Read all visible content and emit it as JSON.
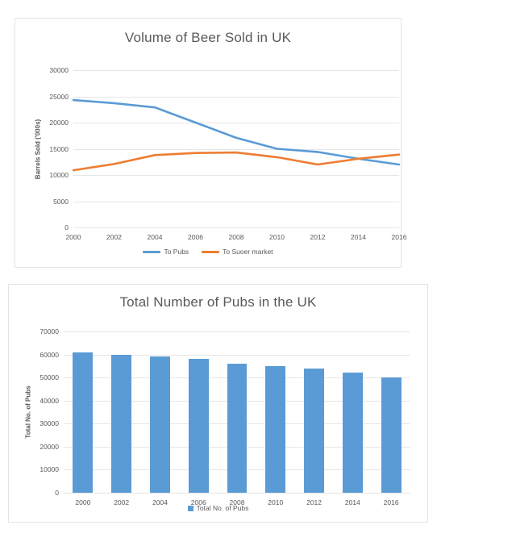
{
  "chart_data": [
    {
      "type": "line",
      "title": "Volume of Beer Sold in UK",
      "xlabel": "",
      "ylabel": "Barrels Sold ('000s)",
      "categories": [
        "2000",
        "2002",
        "2004",
        "2006",
        "2008",
        "2010",
        "2012",
        "2014",
        "2016"
      ],
      "ylim": [
        0,
        30000
      ],
      "yticks": [
        "0",
        "5000",
        "10000",
        "15000",
        "20000",
        "25000",
        "30000"
      ],
      "ytick_values": [
        0,
        5000,
        10000,
        15000,
        20000,
        25000,
        30000
      ],
      "grid": true,
      "legend_position": "bottom",
      "series": [
        {
          "name": "To Pubs",
          "color": "#5b9bd5",
          "values": [
            24300,
            23700,
            22900,
            20000,
            17100,
            15000,
            14400,
            13100,
            12000
          ]
        },
        {
          "name": "To Suoer market",
          "color": "#ed7d31",
          "values": [
            10900,
            12100,
            13800,
            14200,
            14300,
            13400,
            12000,
            13100,
            13900
          ]
        }
      ]
    },
    {
      "type": "bar",
      "title": "Total Number of Pubs in the UK",
      "xlabel": "",
      "ylabel": "Total No. of Pubs",
      "categories": [
        "2000",
        "2002",
        "2004",
        "2006",
        "2008",
        "2010",
        "2012",
        "2014",
        "2016"
      ],
      "ylim": [
        0,
        70000
      ],
      "yticks": [
        "0",
        "10000",
        "20000",
        "30000",
        "40000",
        "50000",
        "60000",
        "70000"
      ],
      "ytick_values": [
        0,
        10000,
        20000,
        30000,
        40000,
        50000,
        60000,
        70000
      ],
      "grid": true,
      "legend_position": "bottom",
      "series": [
        {
          "name": "Total No. of Pubs",
          "color": "#5b9bd5",
          "values": [
            61000,
            60000,
            59000,
            58000,
            56000,
            55000,
            54000,
            52000,
            50000
          ]
        }
      ]
    }
  ]
}
